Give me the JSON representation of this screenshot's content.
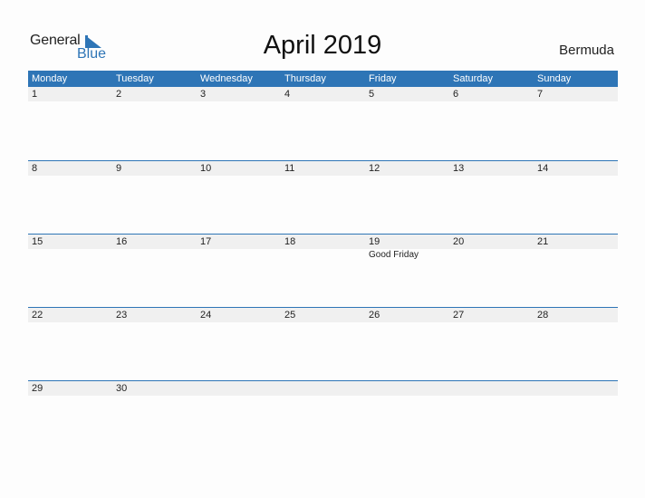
{
  "logo": {
    "word1": "General",
    "word2": "Blue"
  },
  "title": "April 2019",
  "country": "Bermuda",
  "colors": {
    "accent": "#2e75b6",
    "day_row_bg": "#f0f0f0"
  },
  "weekdays": [
    "Monday",
    "Tuesday",
    "Wednesday",
    "Thursday",
    "Friday",
    "Saturday",
    "Sunday"
  ],
  "weeks": [
    {
      "days": [
        "1",
        "2",
        "3",
        "4",
        "5",
        "6",
        "7"
      ],
      "events": [
        "",
        "",
        "",
        "",
        "",
        "",
        ""
      ]
    },
    {
      "days": [
        "8",
        "9",
        "10",
        "11",
        "12",
        "13",
        "14"
      ],
      "events": [
        "",
        "",
        "",
        "",
        "",
        "",
        ""
      ]
    },
    {
      "days": [
        "15",
        "16",
        "17",
        "18",
        "19",
        "20",
        "21"
      ],
      "events": [
        "",
        "",
        "",
        "",
        "Good Friday",
        "",
        ""
      ]
    },
    {
      "days": [
        "22",
        "23",
        "24",
        "25",
        "26",
        "27",
        "28"
      ],
      "events": [
        "",
        "",
        "",
        "",
        "",
        "",
        ""
      ]
    },
    {
      "days": [
        "29",
        "30",
        "",
        "",
        "",
        "",
        ""
      ],
      "events": [
        "",
        "",
        "",
        "",
        "",
        "",
        ""
      ]
    }
  ]
}
